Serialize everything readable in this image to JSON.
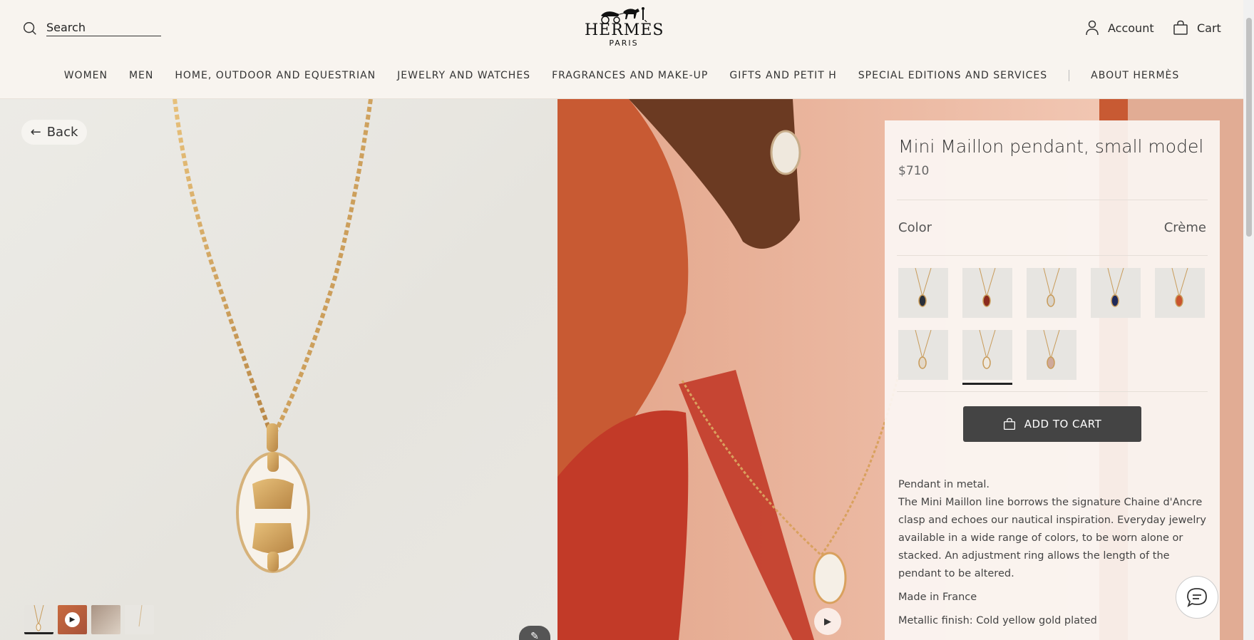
{
  "header": {
    "search_label": "Search",
    "brand_name": "HERMÈS",
    "brand_city": "PARIS",
    "account_label": "Account",
    "cart_label": "Cart"
  },
  "nav": {
    "items": [
      "WOMEN",
      "MEN",
      "HOME, OUTDOOR AND EQUESTRIAN",
      "JEWELRY AND WATCHES",
      "FRAGRANCES AND MAKE-UP",
      "GIFTS AND PETIT H",
      "SPECIAL EDITIONS AND SERVICES"
    ],
    "about": "ABOUT HERMÈS"
  },
  "gallery": {
    "back_label": "Back",
    "thumbnails": [
      "product",
      "video",
      "worn",
      "detail"
    ],
    "active_thumbnail": 0
  },
  "product": {
    "title": "Mini Maillon pendant, small model",
    "price": "$710",
    "color_label": "Color",
    "color_value": "Crème",
    "swatches": [
      {
        "color": "#2a2f3a"
      },
      {
        "color": "#8b2a1e"
      },
      {
        "color": "#d9d4cc"
      },
      {
        "color": "#1f2a5a"
      },
      {
        "color": "#c9542e"
      },
      {
        "color": "#e3d8c8"
      },
      {
        "color": "#efe9df"
      },
      {
        "color": "#cfa99a"
      }
    ],
    "selected_swatch": 6,
    "add_to_cart_label": "ADD TO CART",
    "description": [
      "Pendant in metal.",
      "The Mini Maillon line borrows the signature Chaine d'Ancre clasp and echoes our nautical inspiration. Everyday jewelry available in a wide range of colors, to be worn alone or stacked. An adjustment ring allows the length of the pendant to be altered."
    ],
    "made_in": "Made in France",
    "finish": "Metallic finish: Cold yellow gold plated"
  },
  "colors": {
    "background": "#f8f4ef",
    "button": "#444444",
    "accent_orange": "#c85a33",
    "gold": "#c89b5a"
  }
}
